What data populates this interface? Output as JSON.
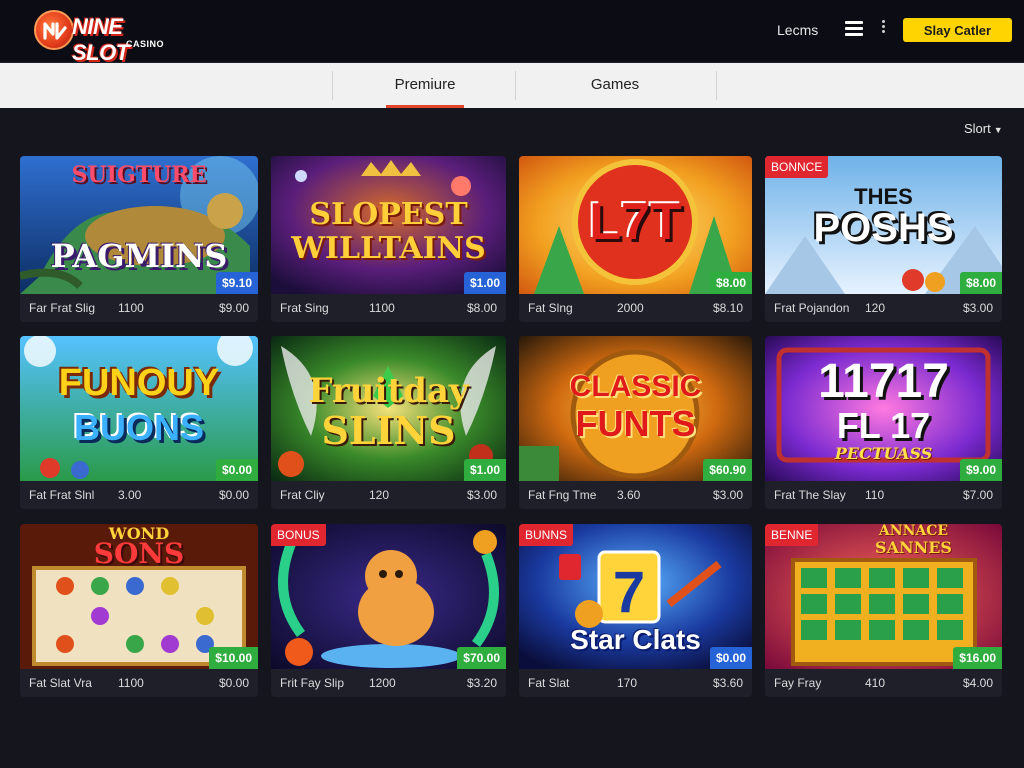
{
  "header": {
    "logo_main": "NINE SLOT",
    "logo_sub": "CASINO",
    "nav_link": "Lecms",
    "cta_label": "Slay Catler"
  },
  "tabs": [
    {
      "label": "Premiure",
      "active": true
    },
    {
      "label": "Games",
      "active": false
    }
  ],
  "sort_label": "Slort",
  "cards": [
    {
      "art_title_1": "SUIGTURE",
      "art_title_2": "PAGMINS",
      "badge": "$9.10",
      "badge_color": "blue",
      "bonus": "",
      "name": "Far Frat Slig",
      "count": "1100",
      "price": "$9.00"
    },
    {
      "art_title_1": "SLOPEST",
      "art_title_2": "WILLTAINS",
      "badge": "$1.00",
      "badge_color": "blue",
      "bonus": "",
      "name": "Frat Sing",
      "count": "1100",
      "price": "$8.00"
    },
    {
      "art_title_1": "L7T",
      "art_title_2": "",
      "badge": "$8.00",
      "badge_color": "green",
      "bonus": "",
      "name": "Fat Slng",
      "count": "2000",
      "price": "$8.10"
    },
    {
      "art_title_1": "THES",
      "art_title_2": "POSHS",
      "badge": "$8.00",
      "badge_color": "green",
      "bonus": "BONNCE",
      "name": "Frat Pojandon",
      "count": "120",
      "price": "$3.00"
    },
    {
      "art_title_1": "FUNOUY",
      "art_title_2": "BUONS",
      "badge": "$0.00",
      "badge_color": "green",
      "bonus": "",
      "name": "Fat Frat Slnl",
      "count": "3.00",
      "price": "$0.00"
    },
    {
      "art_title_1": "Fruitday",
      "art_title_2": "SLINS",
      "badge": "$1.00",
      "badge_color": "green",
      "bonus": "",
      "name": "Frat Cliy",
      "count": "120",
      "price": "$3.00"
    },
    {
      "art_title_1": "CLASSIC",
      "art_title_2": "FUNTS",
      "badge": "$60.90",
      "badge_color": "green",
      "bonus": "",
      "name": "Fat Fng Tme",
      "count": "3.60",
      "price": "$3.00"
    },
    {
      "art_title_1": "11717",
      "art_title_2": "FL  17",
      "art_title_3": "PECTUASS",
      "badge": "$9.00",
      "badge_color": "green",
      "bonus": "",
      "name": "Frat The Slay",
      "count": "110",
      "price": "$7.00"
    },
    {
      "art_title_1": "WOND",
      "art_title_2": "SONS",
      "badge": "$10.00",
      "badge_color": "green",
      "bonus": "",
      "name": "Fat Slat Vra",
      "count": "1100",
      "price": "$0.00"
    },
    {
      "art_title_1": "",
      "art_title_2": "",
      "badge": "$70.00",
      "badge_color": "green",
      "bonus": "BONUS",
      "name": "Frit Fay Slip",
      "count": "1200",
      "price": "$3.20"
    },
    {
      "art_title_1": "Star Clats",
      "art_title_2": "",
      "badge": "$0.00",
      "badge_color": "blue",
      "bonus": "BUNNS",
      "name": "Fat Slat",
      "count": "170",
      "price": "$3.60"
    },
    {
      "art_title_1": "ANNACE",
      "art_title_2": "SANNES",
      "badge": "$16.00",
      "badge_color": "green",
      "bonus": "BENNE",
      "name": "Fay Fray",
      "count": "410",
      "price": "$4.00"
    }
  ]
}
